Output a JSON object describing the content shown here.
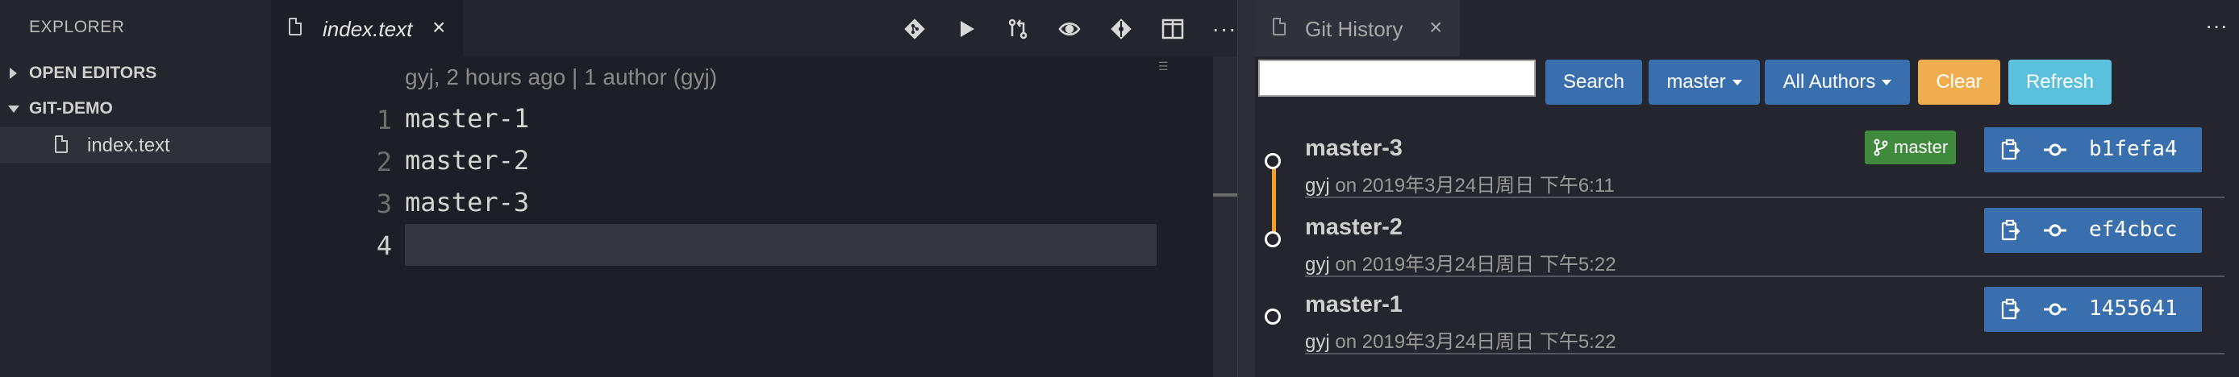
{
  "sidebar": {
    "title": "EXPLORER",
    "sections": [
      {
        "label": "OPEN EDITORS",
        "expanded": false
      },
      {
        "label": "GIT-DEMO",
        "expanded": true
      }
    ],
    "files": [
      {
        "label": "index.text"
      }
    ]
  },
  "editor": {
    "tab": {
      "label": "index.text"
    },
    "blame": "gyj, 2 hours ago | 1 author (gyj)",
    "lines": [
      {
        "no": "1",
        "text": "master-1"
      },
      {
        "no": "2",
        "text": "master-2"
      },
      {
        "no": "3",
        "text": "master-3"
      },
      {
        "no": "4",
        "text": ""
      }
    ],
    "toolbar_icons": [
      "git-icon",
      "run-icon",
      "compare-changes-icon",
      "toggle-blame-icon",
      "git-commit-icon",
      "split-editor-icon",
      "more-actions-icon"
    ]
  },
  "git_history": {
    "tab": {
      "label": "Git History"
    },
    "search": {
      "value": "",
      "placeholder": ""
    },
    "buttons": {
      "search": "Search",
      "branch": "master",
      "authors": "All Authors",
      "clear": "Clear",
      "refresh": "Refresh"
    },
    "commits": [
      {
        "title": "master-3",
        "author": "gyj",
        "on": "on",
        "date": "2019年3月24日周日 下午6:11",
        "branch": "master",
        "sha": "b1fefa4"
      },
      {
        "title": "master-2",
        "author": "gyj",
        "on": "on",
        "date": "2019年3月24日周日 下午5:22",
        "branch": "",
        "sha": "ef4cbcc"
      },
      {
        "title": "master-1",
        "author": "gyj",
        "on": "on",
        "date": "2019年3月24日周日 下午5:22",
        "branch": "",
        "sha": "1455641"
      }
    ]
  },
  "colors": {
    "accent_blue": "#3a6fae",
    "clear_orange": "#f0ad4e",
    "refresh_cyan": "#5bc0de",
    "branch_green": "#3f8a3c",
    "graph_orange": "#f0a02a"
  }
}
